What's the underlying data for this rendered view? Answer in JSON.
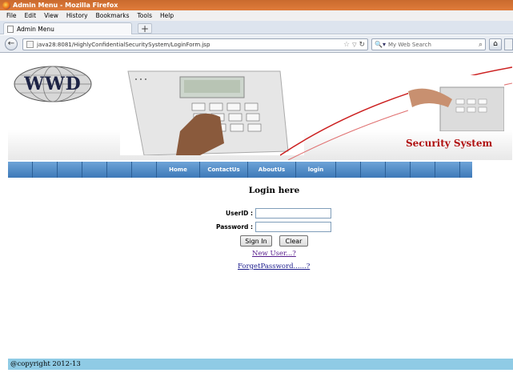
{
  "browser": {
    "window_title": "Admin Menu - Mozilla Firefox",
    "menu": [
      "File",
      "Edit",
      "View",
      "History",
      "Bookmarks",
      "Tools",
      "Help"
    ],
    "tab_title": "Admin Menu",
    "new_tab": "+",
    "url": "java28:8081/HighlyConfidentialSecuritySystem/LoginForm.jsp",
    "search_placeholder": "My Web Search"
  },
  "banner": {
    "logo_text": "WWD",
    "tagline": "Security System"
  },
  "nav": {
    "items": [
      "Home",
      "ContactUs",
      "AboutUs",
      "login"
    ]
  },
  "login": {
    "heading": "Login here",
    "userid_label": "UserID :",
    "password_label": "Password :",
    "userid_value": "",
    "password_value": "",
    "signin_label": "Sign In",
    "clear_label": "Clear",
    "new_user_link": "New User...?",
    "forgot_link": "ForgetPassword......?"
  },
  "footer": {
    "copyright": "@copyright 2012-13"
  },
  "colors": {
    "nav_bar": "#4a86c3",
    "footer": "#8fcbe5",
    "link": "#551a8b",
    "tagline": "#b01010"
  }
}
